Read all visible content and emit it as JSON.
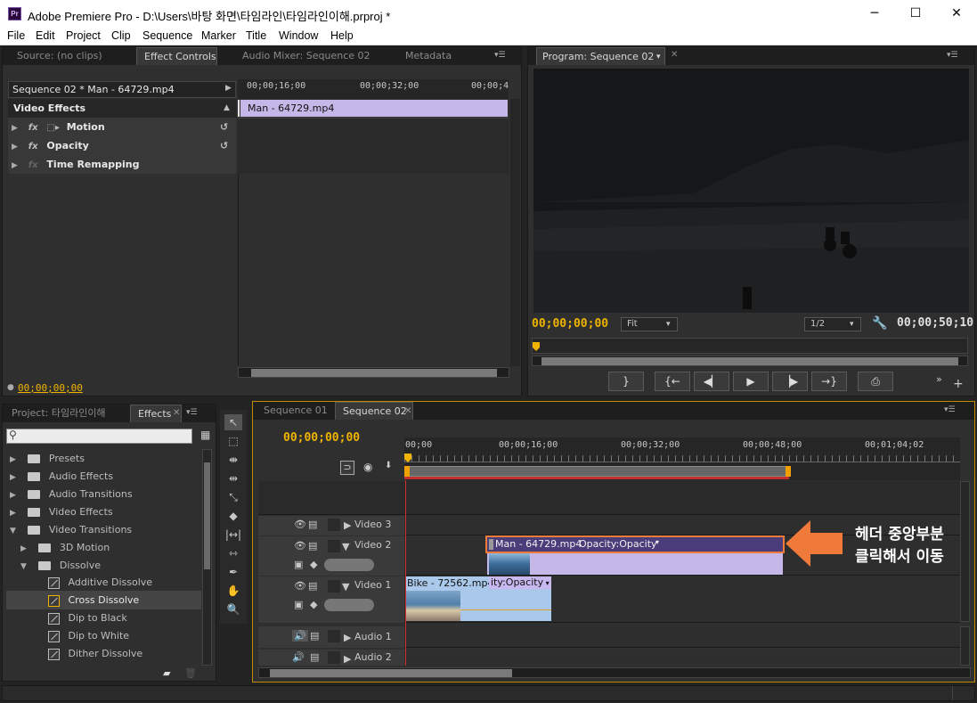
{
  "window": {
    "app_icon": "Pr",
    "title": "Adobe Premiere Pro - D:\\Users\\바탕 화면\\타임라인\\타임라인이해.prproj *",
    "minimize": "─",
    "maximize": "☐",
    "close": "✕"
  },
  "menu": [
    "File",
    "Edit",
    "Project",
    "Clip",
    "Sequence",
    "Marker",
    "Title",
    "Window",
    "Help"
  ],
  "top_left_panel": {
    "tabs": [
      "Source: (no clips)",
      "Effect Controls",
      "Audio Mixer: Sequence 02",
      "Metadata"
    ],
    "active_tab": "Effect Controls",
    "clip_header": "Sequence 02 * Man - 64729.mp4",
    "ruler_times": [
      "00;00;16;00",
      "00;00;32;00",
      "00;00;4"
    ],
    "clip_bar": "Man - 64729.mp4",
    "section": "Video Effects",
    "effects": [
      {
        "label": "Motion",
        "resettable": true
      },
      {
        "label": "Opacity",
        "resettable": true
      },
      {
        "label": "Time Remapping",
        "resettable": false
      }
    ],
    "footer_time": "00;00;00;00"
  },
  "program_monitor": {
    "tab": "Program: Sequence 02",
    "current_time": "00;00;00;00",
    "zoom": "Fit",
    "resolution": "1/2",
    "duration": "00;00;50;10"
  },
  "project_panel": {
    "tabs": [
      "Project: 타임라인이해",
      "Effects"
    ],
    "active_tab": "Effects",
    "search_placeholder": "",
    "tree": [
      {
        "label": "Presets",
        "level": 0,
        "type": "folder",
        "expanded": false
      },
      {
        "label": "Audio Effects",
        "level": 0,
        "type": "folder",
        "expanded": false
      },
      {
        "label": "Audio Transitions",
        "level": 0,
        "type": "folder",
        "expanded": false
      },
      {
        "label": "Video Effects",
        "level": 0,
        "type": "folder",
        "expanded": false
      },
      {
        "label": "Video Transitions",
        "level": 0,
        "type": "folder",
        "expanded": true
      },
      {
        "label": "3D Motion",
        "level": 1,
        "type": "folder",
        "expanded": false
      },
      {
        "label": "Dissolve",
        "level": 1,
        "type": "folder",
        "expanded": true
      },
      {
        "label": "Additive Dissolve",
        "level": 2,
        "type": "effect"
      },
      {
        "label": "Cross Dissolve",
        "level": 2,
        "type": "effect",
        "selected": true
      },
      {
        "label": "Dip to Black",
        "level": 2,
        "type": "effect"
      },
      {
        "label": "Dip to White",
        "level": 2,
        "type": "effect"
      },
      {
        "label": "Dither Dissolve",
        "level": 2,
        "type": "effect"
      }
    ]
  },
  "timeline": {
    "tabs": [
      "Sequence 01",
      "Sequence 02"
    ],
    "active_tab": "Sequence 02",
    "current_time": "00;00;00;00",
    "ruler_times": [
      "00;00",
      "00;00;16;00",
      "00;00;32;00",
      "00;00;48;00",
      "00;01;04;02"
    ],
    "tracks": {
      "video3": "Video 3",
      "video2": "Video 2",
      "video1": "Video 1",
      "audio1": "Audio 1",
      "audio2": "Audio 2"
    },
    "clips": {
      "v2_name": "Man - 64729.mp4",
      "v2_fx": "Opacity:Opacity",
      "v1_name": "Bike - 72562.mp4",
      "v1_fx": "ity:Opacity"
    }
  },
  "annotation": {
    "line1": "헤더 중앙부분",
    "line2": "클릭해서 이동",
    "color": "#f07a3a"
  }
}
